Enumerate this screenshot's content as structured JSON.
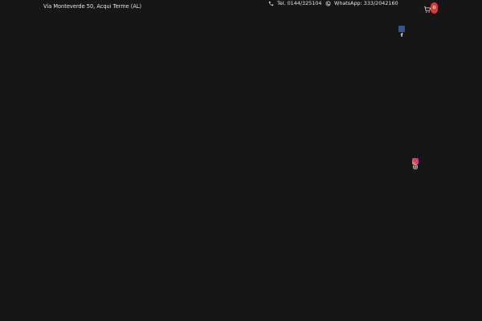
{
  "topbar": {
    "address": "Via Monteverde 50, Acqui Terme (AL)",
    "phone": "Tel. 0144/325104",
    "whatsapp": "WhatsApp: 333/2042160",
    "cart_count": "0"
  },
  "social": {
    "facebook_icon": "facebook-icon",
    "instagram_icon": "instagram-icon"
  },
  "colors": {
    "background": "#161616",
    "text": "#e6e6e6",
    "cart_badge": "#d83a3a",
    "facebook": "#2f5597"
  }
}
